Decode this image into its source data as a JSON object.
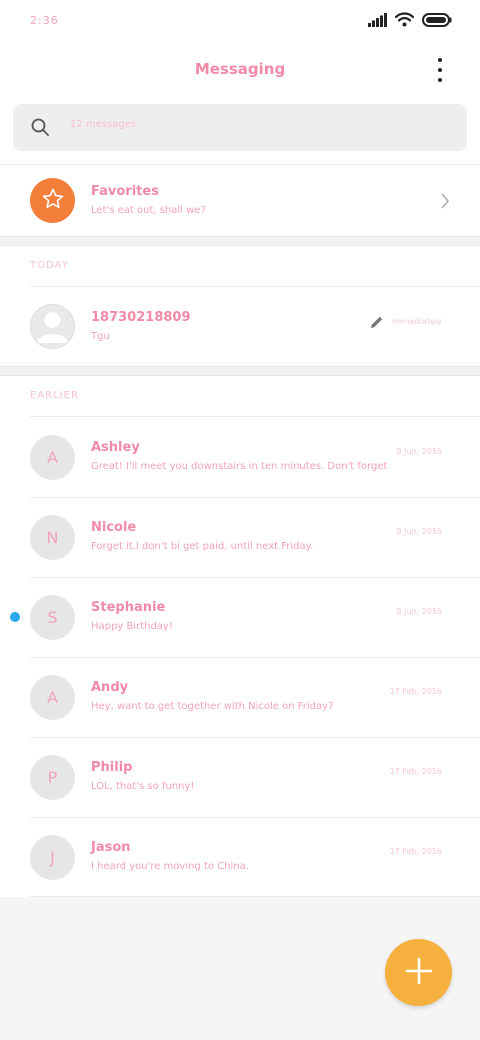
{
  "status": {
    "time": "2:36"
  },
  "header": {
    "title": "Messaging",
    "menu_icon": "more-vertical-icon"
  },
  "search": {
    "placeholder": "12 messages"
  },
  "favorites": {
    "name": "Favorites",
    "preview": "Let's eat out, shall we?",
    "icon_color": "#f47f3a"
  },
  "sections": {
    "today": "TODAY",
    "earlier": "EARLIER"
  },
  "today": [
    {
      "name": "18730218809",
      "preview": "Tgu",
      "date": "Immediately"
    }
  ],
  "earlier": [
    {
      "initial": "A",
      "name": "Ashley",
      "preview": "Great! I'll meet you downstairs in ten minutes. Don't forget",
      "date": "9 Jun, 2016",
      "unread": false
    },
    {
      "initial": "N",
      "name": "Nicole",
      "preview": "Forget it.I don't bi get paid. until next Friday.",
      "date": "9 Jun, 2016",
      "unread": false
    },
    {
      "initial": "S",
      "name": "Stephanie",
      "preview": "Happy Birthday!",
      "date": "8 Jun, 2016",
      "unread": true
    },
    {
      "initial": "A",
      "name": "Andy",
      "preview": "Hey, want to get together with Nicole on Friday?",
      "date": "17 Feb, 2016",
      "unread": false
    },
    {
      "initial": "P",
      "name": "Philip",
      "preview": "LOL, that's so funny!",
      "date": "17 Feb, 2016",
      "unread": false
    },
    {
      "initial": "J",
      "name": "Jason",
      "preview": "I heard you're moving to China.",
      "date": "17 Feb, 2016",
      "unread": false
    }
  ],
  "colors": {
    "accent_text": "#f08aa6",
    "fab": "#f6b03d",
    "unread_dot": "#29a8ea"
  }
}
